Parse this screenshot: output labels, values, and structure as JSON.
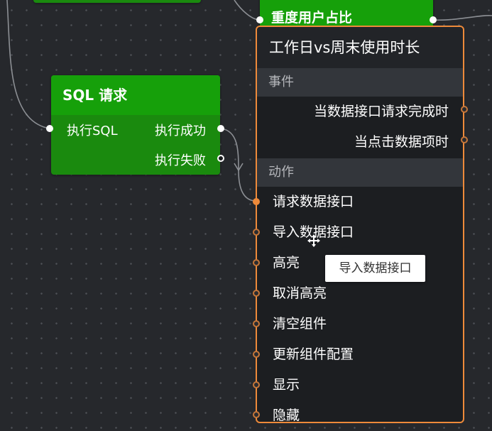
{
  "sql_node": {
    "title": "SQL 请求",
    "input_label": "执行SQL",
    "outputs": [
      "执行成功",
      "执行失败"
    ]
  },
  "top_node": {
    "title": "重度用户占比"
  },
  "event_node": {
    "title": "工作日vs周末使用时长",
    "events_header": "事件",
    "events": [
      "当数据接口请求完成时",
      "当点击数据项时"
    ],
    "actions_header": "动作",
    "actions": [
      "请求数据接口",
      "导入数据接口",
      "高亮",
      "取消高亮",
      "清空组件",
      "更新组件配置",
      "显示",
      "隐藏"
    ]
  },
  "tooltip": "导入数据接口",
  "colors": {
    "canvas": "#26282c",
    "node_green": "#1a8a0e",
    "accent_orange": "#ee8a3a"
  },
  "cursor_icon": "move-cursor-icon"
}
